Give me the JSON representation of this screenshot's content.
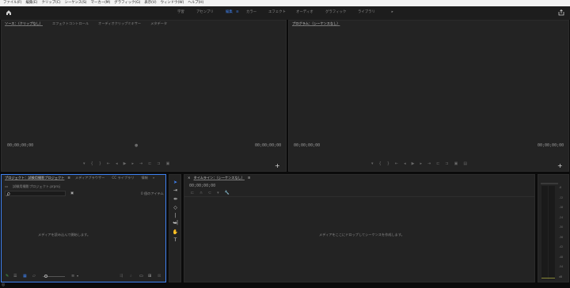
{
  "menu": [
    "ファイル(F)",
    "編集(E)",
    "クリップ(C)",
    "シーケンス(S)",
    "マーカー(M)",
    "グラフィック(G)",
    "表示(V)",
    "ウィンドウ(W)",
    "ヘルプ(H)"
  ],
  "workspaces": {
    "items": [
      "学習",
      "アセンブリ",
      "編集",
      "カラー",
      "エフェクト",
      "オーディオ",
      "グラフィック",
      "ライブラリ"
    ],
    "active": "編集",
    "more": "»"
  },
  "source_panel": {
    "tabs": [
      "ソース：（クリップなし）",
      "エフェクトコントロール",
      "オーディオクリップミキサー",
      "メタデータ"
    ],
    "timecode_left": "00;00;00;00",
    "timecode_right": "00;00;00;00",
    "add_label": "+"
  },
  "program_panel": {
    "tab": "プログラム：（シーケンスなし）",
    "timecode_left": "00;00;00;00",
    "timecode_right": "00;00;00;00",
    "add_label": "+"
  },
  "project_panel": {
    "tabs": [
      "プロジェクト：試験用撮影プロジェクト",
      "メディアブラウザー",
      "CC ライブラリ",
      "情報"
    ],
    "project_file": "試験用撮影プロジェクト.prproj",
    "item_count": "0 個のアイテム",
    "empty_message": "メディアを読み込んで開始します。"
  },
  "timeline_panel": {
    "tab": "タイムライン：（シーケンスなし）",
    "timecode": "00;00;00;00",
    "empty_message": "メディアをここにドロップしてシーケンスを作成します。"
  },
  "audio_meter": {
    "labels": [
      "-6",
      "-12",
      "-18",
      "-24",
      "-30",
      "-36",
      "-42",
      "-48",
      "-54",
      "dB"
    ]
  },
  "colors": {
    "accent": "#3f82f2",
    "panel_bg": "#232323",
    "app_bg": "#0b0b0b",
    "menubar_bg": "#f3f3f3"
  }
}
